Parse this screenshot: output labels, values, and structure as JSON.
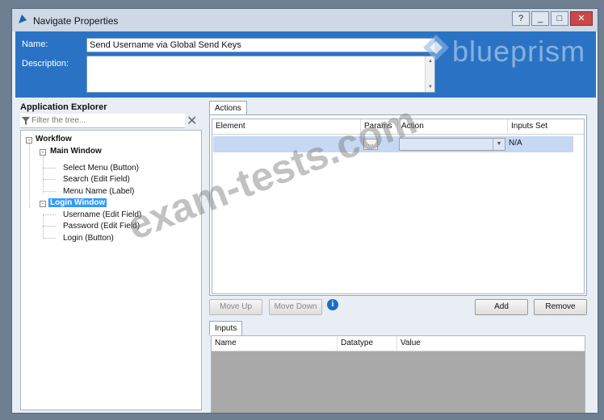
{
  "window": {
    "title": "Navigate Properties",
    "help": "?",
    "minimize": "_",
    "maximize": "□",
    "close": "✕"
  },
  "header": {
    "name_label": "Name:",
    "name_value": "Send Username via Global Send Keys",
    "description_label": "Description:",
    "description_value": ""
  },
  "logo": {
    "text": "blueprism"
  },
  "explorer": {
    "title": "Application Explorer",
    "filter_placeholder": "Filter the tree...",
    "tree": {
      "workflow": "Workflow",
      "main_window": "Main Window",
      "select_menu": "Select Menu (Button)",
      "search": "Search (Edit Field)",
      "menu_name": "Menu Name (Label)",
      "login_window": "Login Window",
      "username": "Username (Edit Field)",
      "password": "Password (Edit Field)",
      "login": "Login (Button)"
    }
  },
  "actions": {
    "tab": "Actions",
    "columns": {
      "element": "Element",
      "params": "Params",
      "action": "Action",
      "inputs_set": "Inputs Set"
    },
    "row": {
      "element": "",
      "params_button": "...",
      "action": "",
      "inputs_set": "N/A"
    },
    "buttons": {
      "move_up": "Move Up",
      "move_down": "Move Down",
      "add": "Add",
      "remove": "Remove"
    }
  },
  "inputs": {
    "tab": "Inputs",
    "columns": {
      "name": "Name",
      "datatype": "Datatype",
      "value": "Value"
    }
  },
  "watermark": "exam-tests.com",
  "colors": {
    "header_blue": "#2a73c4",
    "selection_blue": "#3399ff",
    "row_highlight": "#c6d8f2"
  }
}
